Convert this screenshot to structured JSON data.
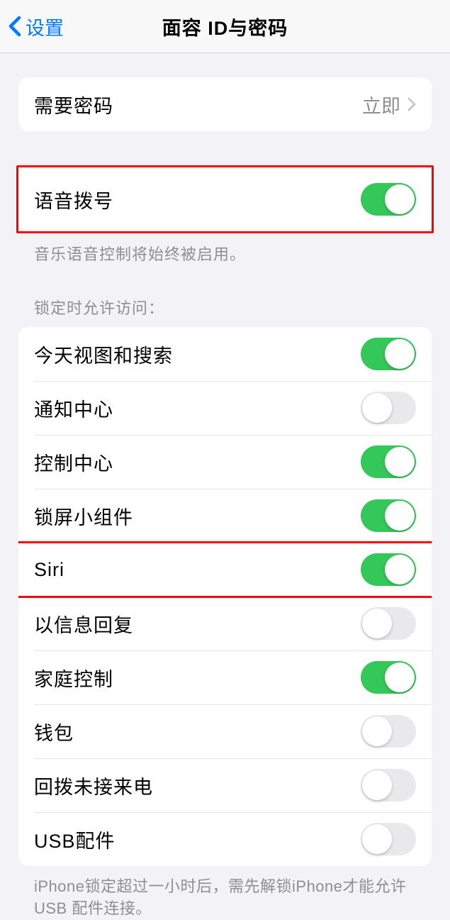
{
  "header": {
    "back_label": "设置",
    "title": "面容 ID与密码"
  },
  "passcode_section": {
    "label": "需要密码",
    "value": "立即"
  },
  "voice_dial": {
    "label": "语音拨号",
    "enabled": true,
    "footer": "音乐语音控制将始终被启用。"
  },
  "lock_access": {
    "header": "锁定时允许访问：",
    "items": [
      {
        "label": "今天视图和搜索",
        "enabled": true
      },
      {
        "label": "通知中心",
        "enabled": false
      },
      {
        "label": "控制中心",
        "enabled": true
      },
      {
        "label": "锁屏小组件",
        "enabled": true
      },
      {
        "label": "Siri",
        "enabled": true
      },
      {
        "label": "以信息回复",
        "enabled": false
      },
      {
        "label": "家庭控制",
        "enabled": true
      },
      {
        "label": "钱包",
        "enabled": false
      },
      {
        "label": "回拨未接来电",
        "enabled": false
      },
      {
        "label": "USB配件",
        "enabled": false
      }
    ],
    "footer": "iPhone锁定超过一小时后，需先解锁iPhone才能允许USB 配件连接。"
  }
}
